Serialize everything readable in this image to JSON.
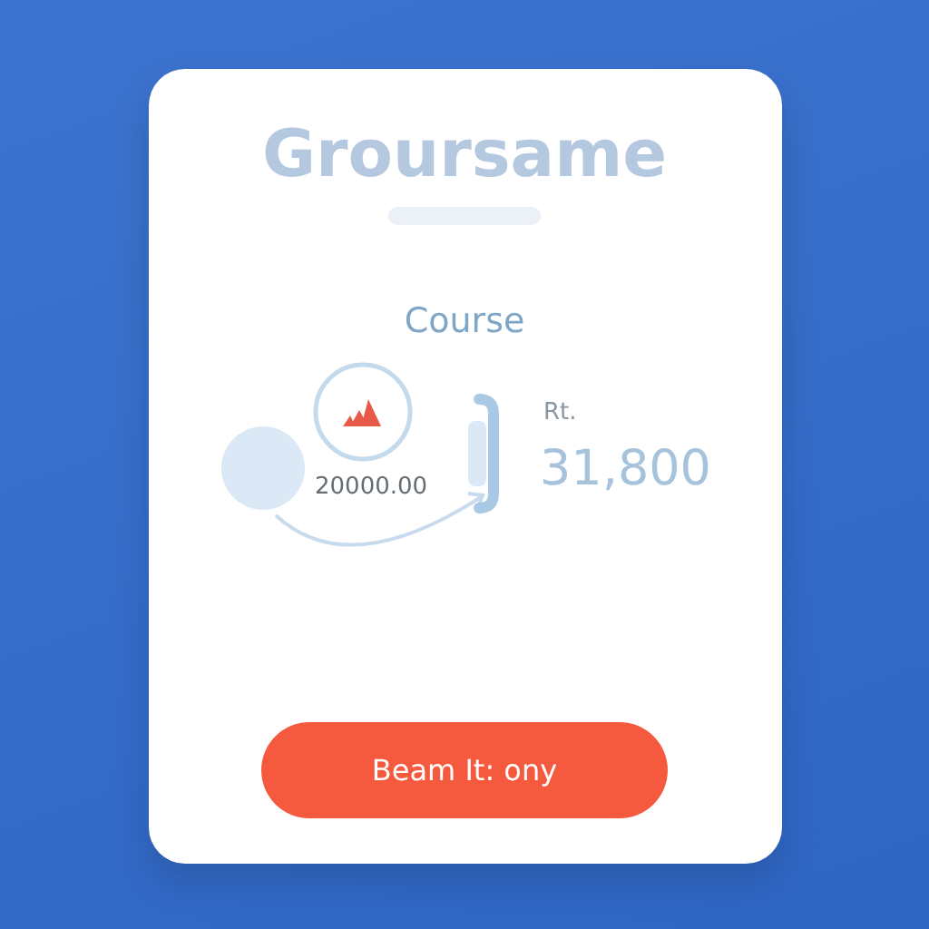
{
  "title": "Groursame",
  "subtitle": "Course",
  "diagram": {
    "amount": "20000.00",
    "currency": "Rt.",
    "total": "31,800"
  },
  "button": "Beam It: ony"
}
